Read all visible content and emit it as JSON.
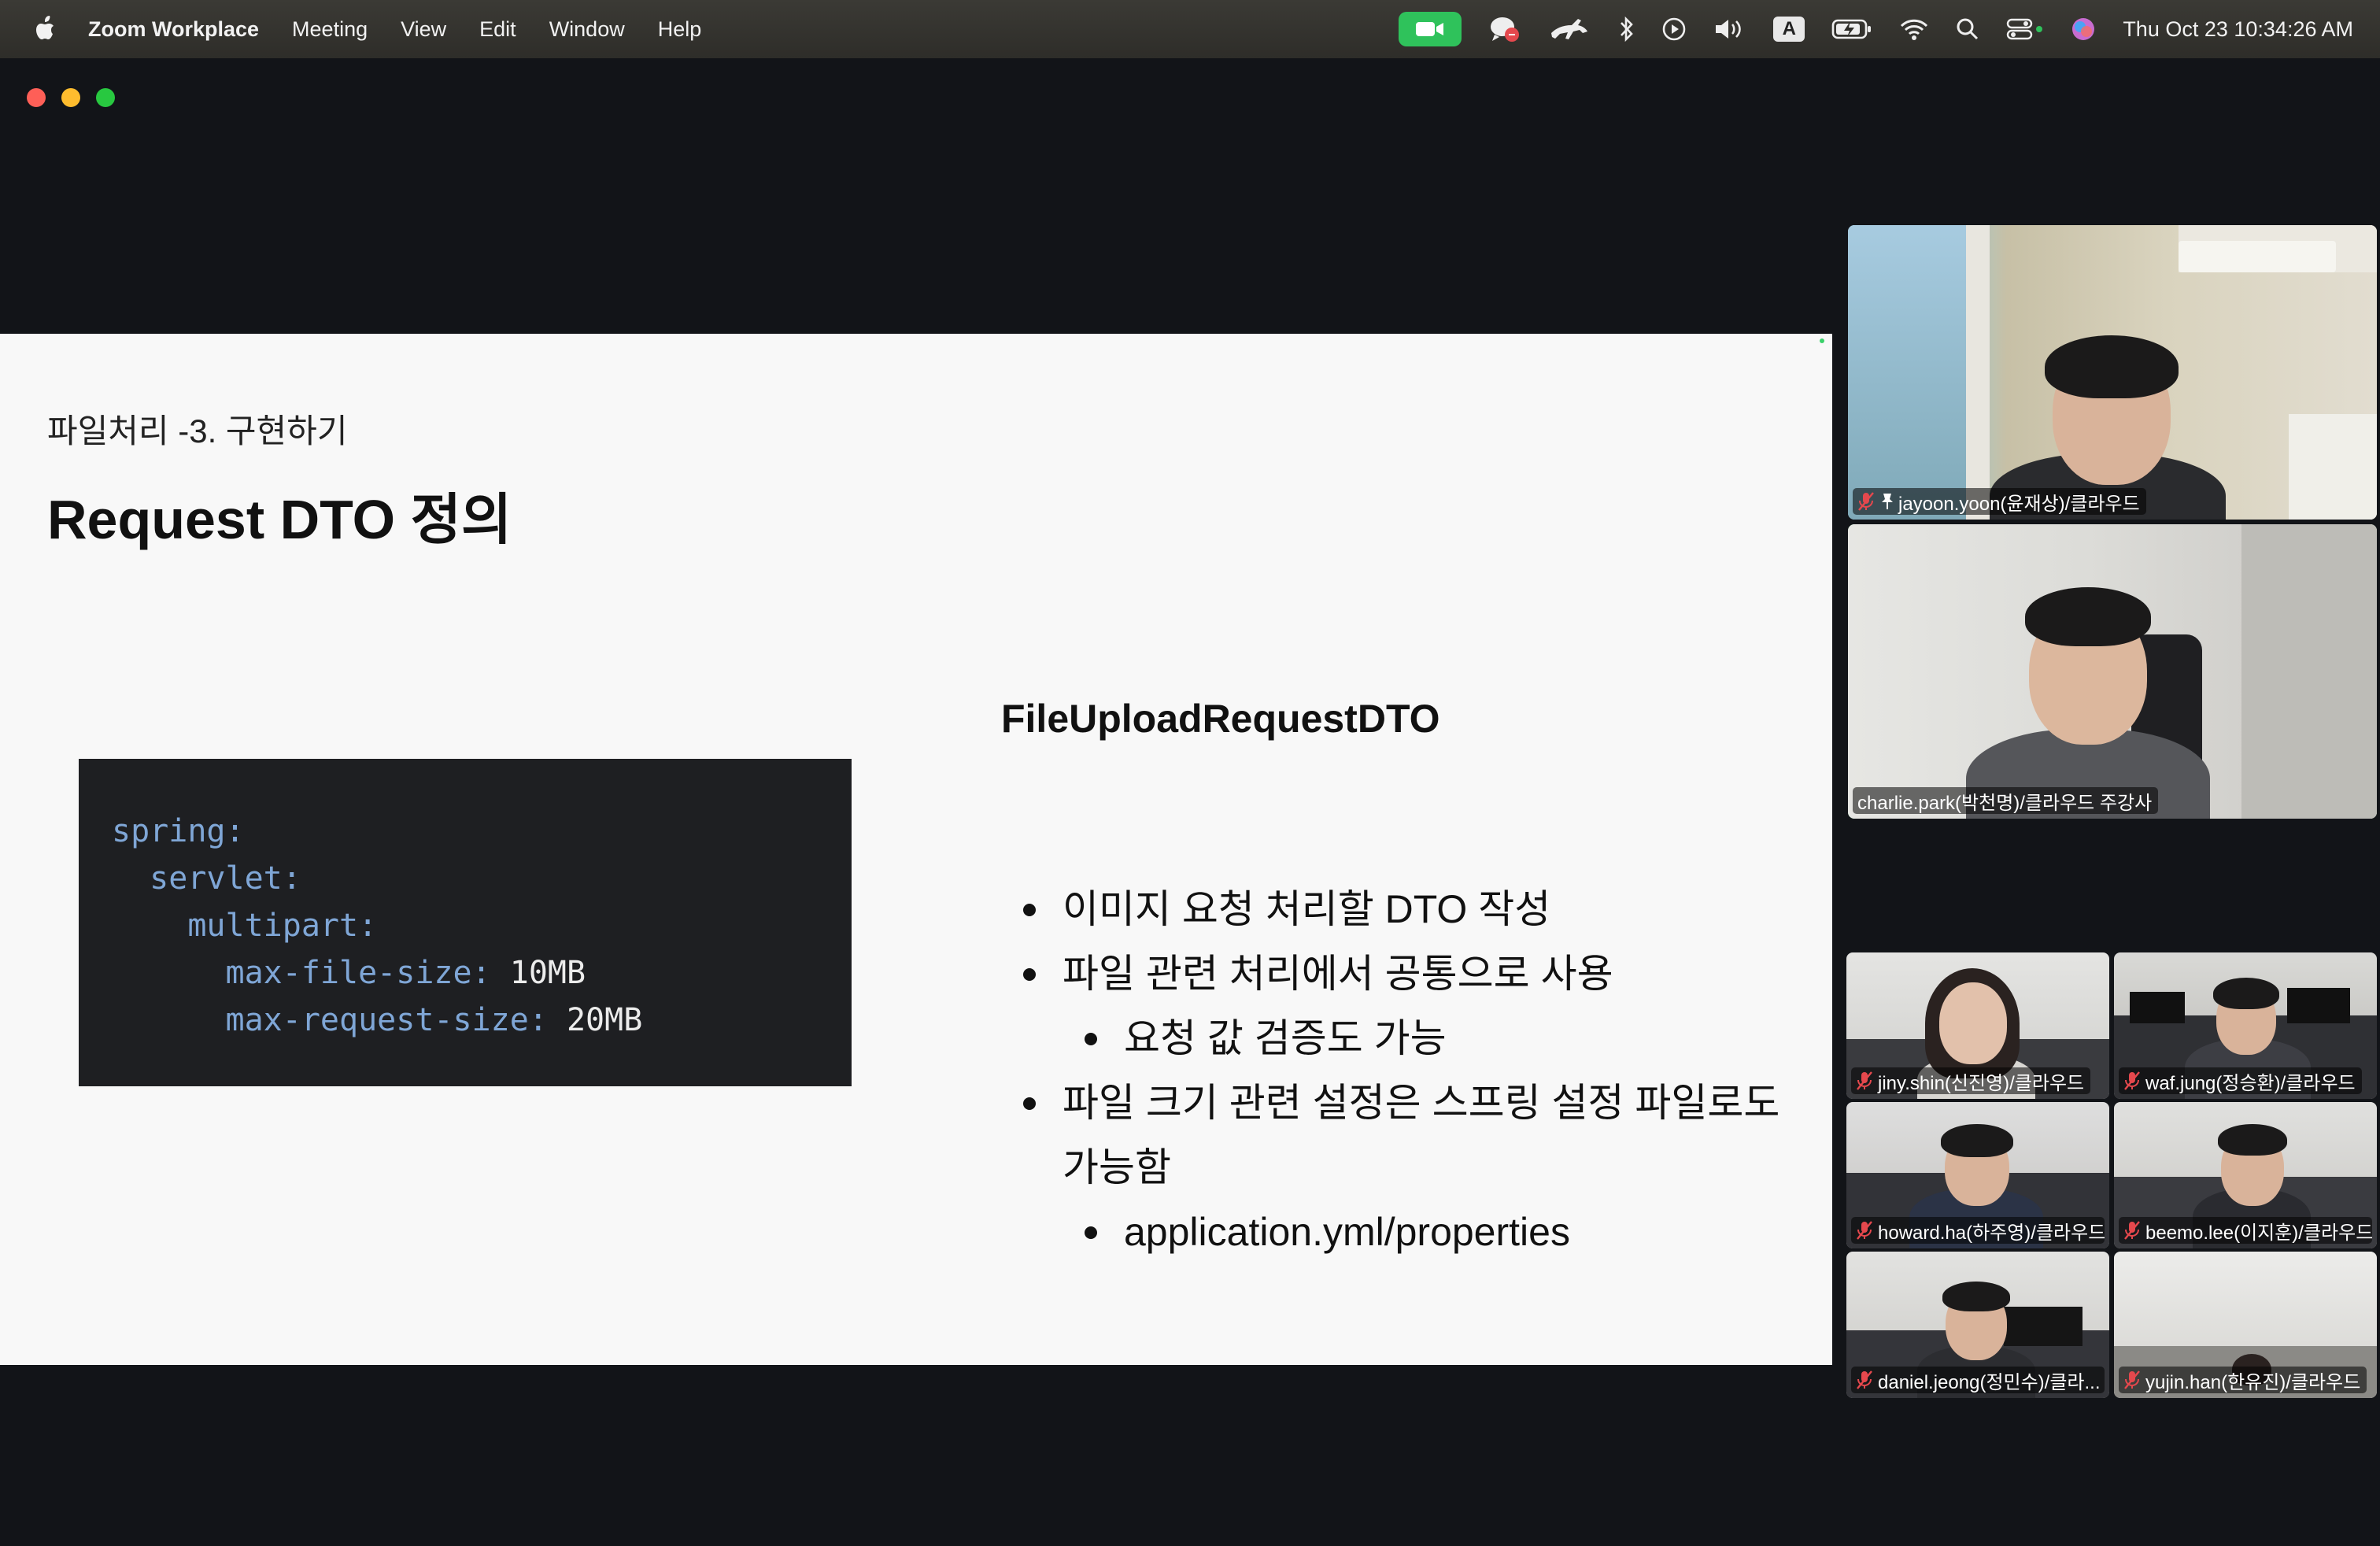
{
  "menubar": {
    "app_name": "Zoom Workplace",
    "menus": [
      "Meeting",
      "View",
      "Edit",
      "Window",
      "Help"
    ],
    "input_source": "A",
    "clock": "Thu Oct 23  10:34:26 AM"
  },
  "slide": {
    "subtitle": "파일처리 -3. 구현하기",
    "title": "Request DTO 정의",
    "code": [
      {
        "key": "spring:",
        "value": ""
      },
      {
        "key": "  servlet:",
        "value": ""
      },
      {
        "key": "    multipart:",
        "value": ""
      },
      {
        "key": "      max-file-size: ",
        "value": "10MB"
      },
      {
        "key": "      max-request-size: ",
        "value": "20MB"
      }
    ],
    "right_heading": "FileUploadRequestDTO",
    "bullets": [
      {
        "text": "이미지 요청 처리할 DTO 작성",
        "level": 1
      },
      {
        "text": "파일 관련 처리에서 공통으로 사용",
        "level": 1
      },
      {
        "text": "요청 값 검증도 가능",
        "level": 2
      },
      {
        "text": "파일 크기 관련 설정은 스프링 설정 파일로도",
        "level": 1
      },
      {
        "text": "가능함",
        "level": 0
      },
      {
        "text": "application.yml/properties",
        "level": 2
      }
    ]
  },
  "participants": {
    "pinned": {
      "name": "jayoon.yoon(윤재상)/클라우드",
      "muted": true,
      "pinned": true
    },
    "speaker": {
      "name": "charlie.park(박천명)/클라우드 주강사",
      "muted": false
    },
    "grid": [
      {
        "name": "jiny.shin(신진영)/클라우드",
        "muted": true
      },
      {
        "name": "waf.jung(정승환)/클라우드",
        "muted": true
      },
      {
        "name": "howard.ha(하주영)/클라우드",
        "muted": true
      },
      {
        "name": "beemo.lee(이지훈)/클라우드",
        "muted": true
      },
      {
        "name": "daniel.jeong(정민수)/클라...",
        "muted": true
      },
      {
        "name": "yujin.han(한유진)/클라우드",
        "muted": true
      }
    ]
  },
  "colors": {
    "zoom_green": "#2fc25b",
    "active_speaker_border": "#3ec766",
    "code_key": "#7fa6d6",
    "mute_red": "#e5484d"
  }
}
